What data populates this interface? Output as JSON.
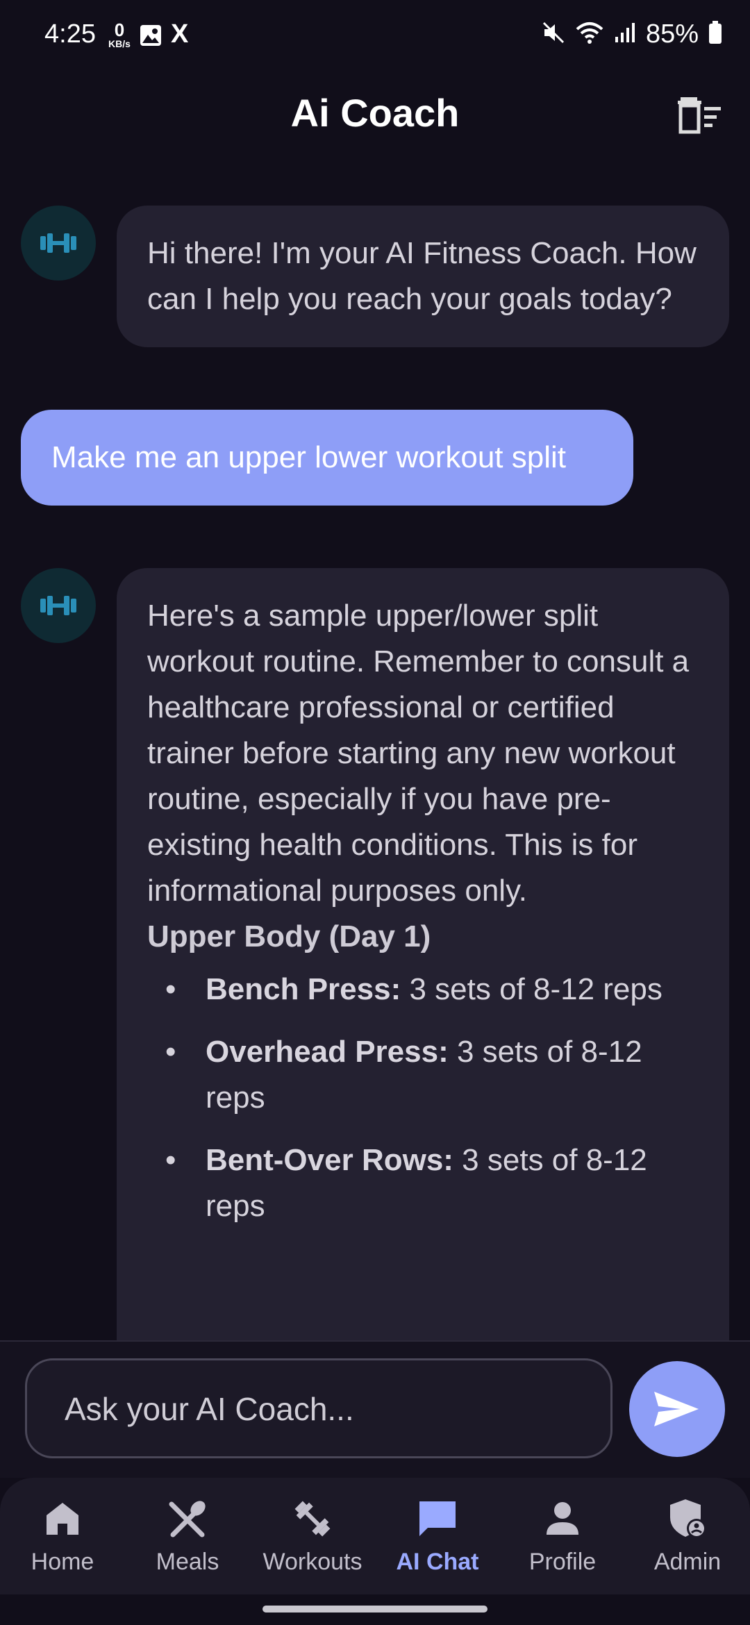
{
  "status_bar": {
    "time": "4:25",
    "net_speed_value": "0",
    "net_speed_unit": "KB/s",
    "x_logo": "X",
    "battery": "85%"
  },
  "header": {
    "title": "Ai Coach"
  },
  "messages": [
    {
      "role": "ai",
      "text": "Hi there! I'm your AI Fitness Coach. How can I help you reach your goals today?"
    },
    {
      "role": "user",
      "text": "Make me an upper lower workout split"
    },
    {
      "role": "ai",
      "intro": "Here's a sample upper/lower split workout routine.  Remember to consult a healthcare professional or certified trainer before starting any new workout routine, especially if you have pre-existing health conditions. This is for informational purposes only.",
      "section_title": "Upper Body (Day 1)",
      "bullet": "•",
      "exercises": [
        {
          "name": "Bench Press:",
          "detail": " 3 sets of 8-12 reps"
        },
        {
          "name": "Overhead Press:",
          "detail": " 3 sets of 8-12 reps"
        },
        {
          "name": "Bent-Over Rows:",
          "detail": " 3 sets of 8-12 reps"
        }
      ]
    }
  ],
  "input": {
    "placeholder": "Ask your AI Coach..."
  },
  "nav": [
    {
      "label": "Home",
      "icon": "home-icon"
    },
    {
      "label": "Meals",
      "icon": "utensils-icon"
    },
    {
      "label": "Workouts",
      "icon": "dumbbell-icon"
    },
    {
      "label": "AI Chat",
      "icon": "chat-icon",
      "active": true
    },
    {
      "label": "Profile",
      "icon": "person-icon"
    },
    {
      "label": "Admin",
      "icon": "admin-shield-icon"
    }
  ],
  "colors": {
    "background": "#110e1a",
    "accent": "#8e9ef7",
    "ai_bubble": "#242131",
    "active_nav": "#9aaaff"
  }
}
